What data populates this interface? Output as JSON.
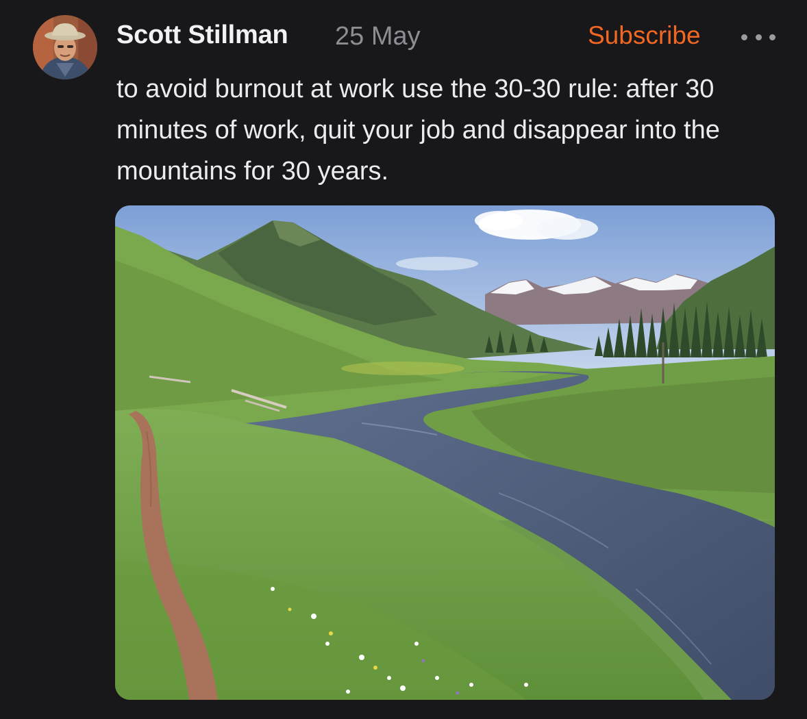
{
  "post": {
    "author_name": "Scott Stillman",
    "date": "25 May",
    "subscribe_label": "Subscribe",
    "more_icon": "more-horizontal-icon",
    "text": "to avoid burnout at work use the 30-30 rule: after 30 minutes of work, quit your job and disappear into the mountains for 30 years."
  },
  "colors": {
    "background": "#18181b",
    "subscribe_accent": "#f26722",
    "date_text": "#8d8d94",
    "body_text": "#ececef"
  }
}
